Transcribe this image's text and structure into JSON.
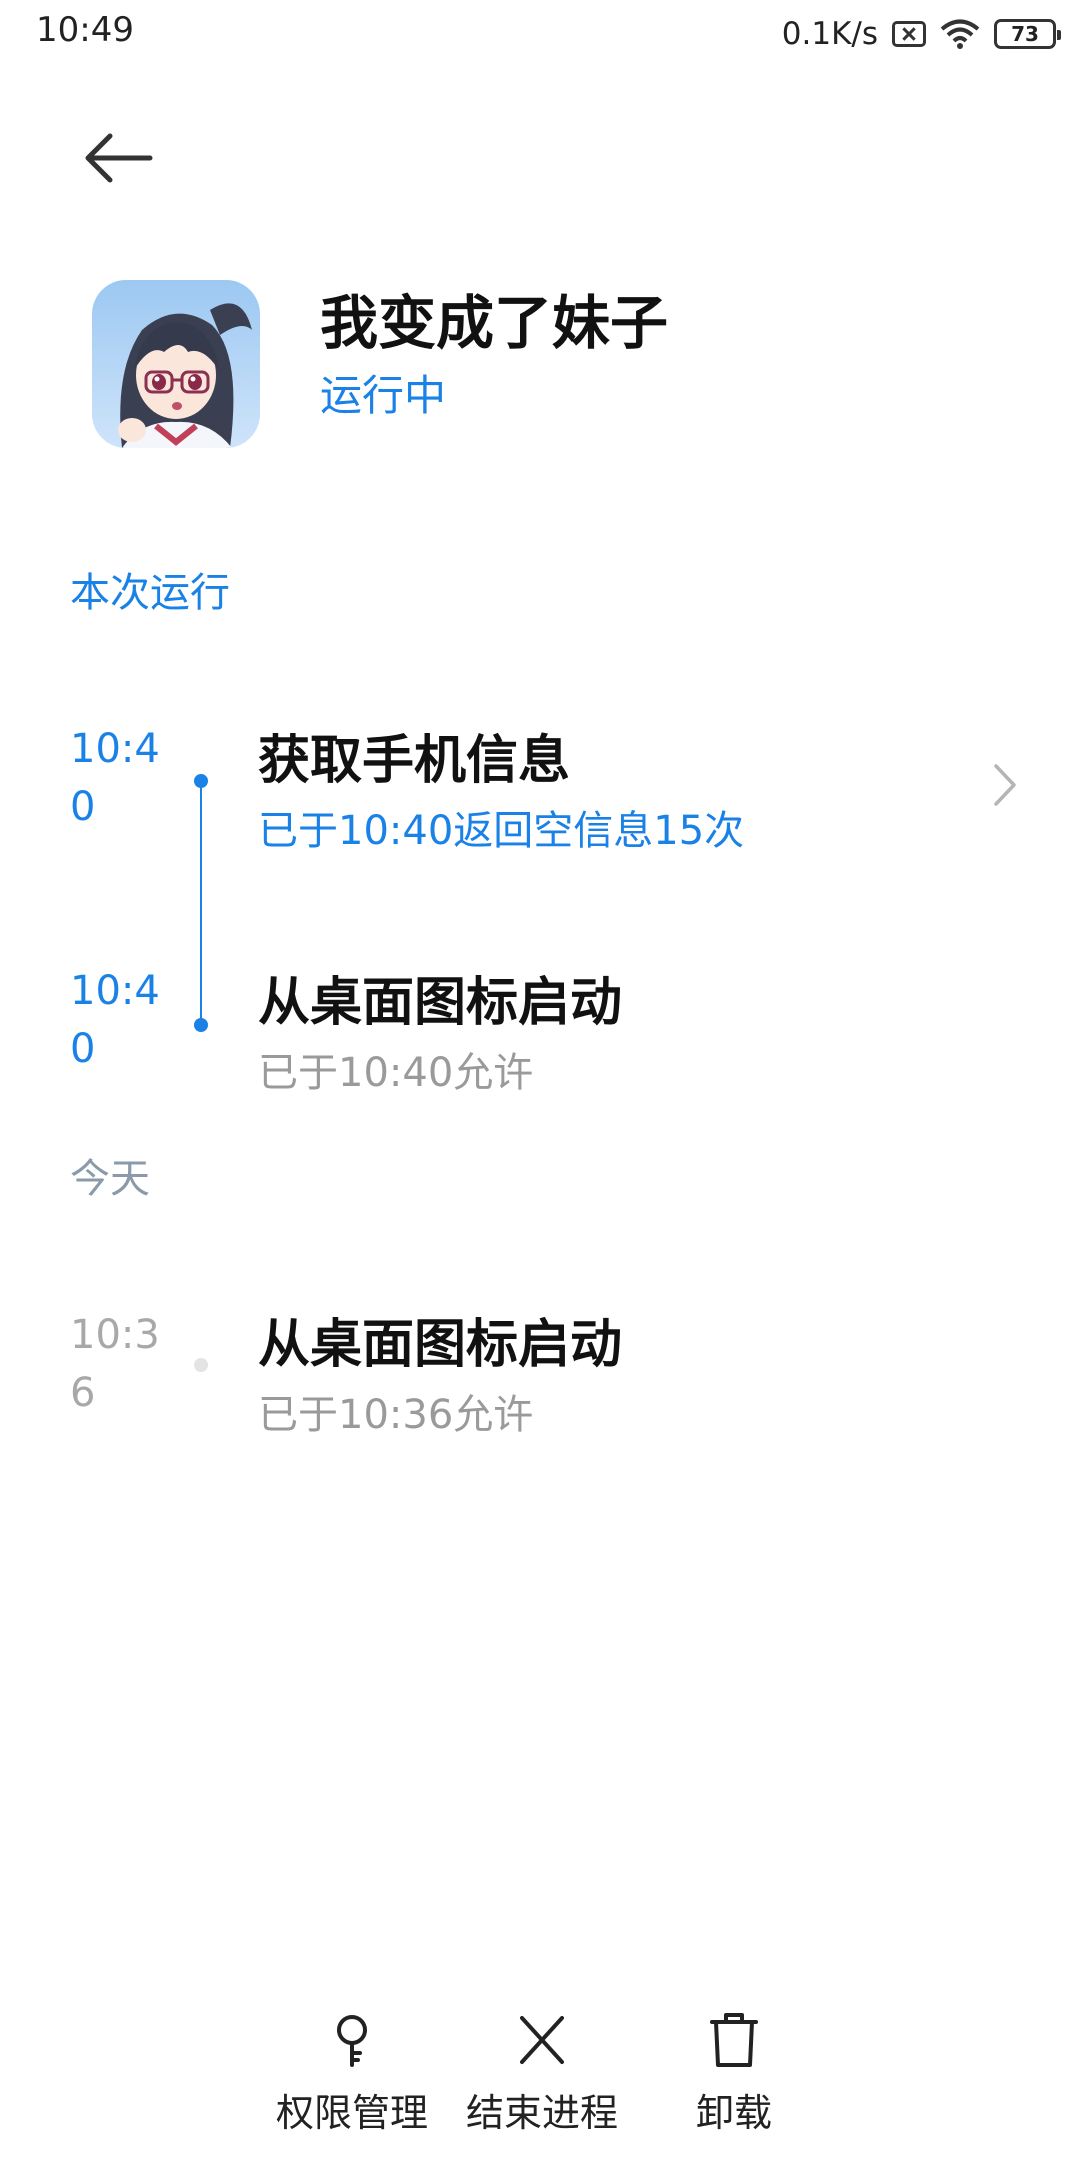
{
  "status_bar": {
    "time": "10:49",
    "net_speed": "0.1K/s",
    "battery": "73"
  },
  "app": {
    "name": "我变成了妹子",
    "status": "运行中"
  },
  "sections": {
    "current_run": "本次运行",
    "today": "今天"
  },
  "current_events": [
    {
      "time": "10:40",
      "title": "获取手机信息",
      "detail": "已于10:40返回空信息15次"
    },
    {
      "time": "10:40",
      "title": "从桌面图标启动",
      "detail": "已于10:40允许"
    }
  ],
  "today_events": [
    {
      "time": "10:36",
      "title": "从桌面图标启动",
      "detail": "已于10:36允许"
    }
  ],
  "actions": {
    "permissions": "权限管理",
    "end_process": "结束进程",
    "uninstall": "卸载"
  },
  "colors": {
    "accent": "#1a82e6",
    "muted": "#9a9a9a",
    "section_gray": "#8a9aaa"
  }
}
